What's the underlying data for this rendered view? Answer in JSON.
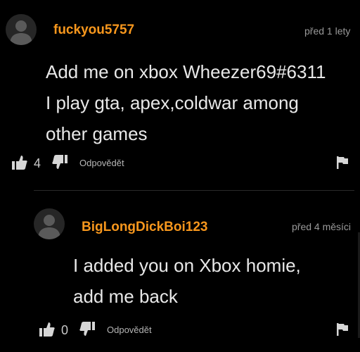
{
  "comments": [
    {
      "username": "fuckyou5757",
      "timestamp": "před 1 lety",
      "body_lines": [
        "Add me on xbox Wheezer69#6311",
        "I play gta, apex,coldwar among",
        "other games"
      ],
      "like_count": "4",
      "reply_label": "Odpovědět"
    },
    {
      "username": "BigLongDickBoi123",
      "timestamp": "před 4 měsíci",
      "body_lines": [
        "I added you on Xbox homie,",
        "add me back"
      ],
      "like_count": "0",
      "reply_label": "Odpovědět"
    }
  ],
  "colors": {
    "background": "#000000",
    "username": "#f7971d",
    "body_text": "#e8e8e8",
    "meta_text": "#9a9a9a"
  },
  "icons": [
    "user-avatar-icon",
    "thumbs-up-icon",
    "thumbs-down-icon",
    "flag-icon"
  ]
}
